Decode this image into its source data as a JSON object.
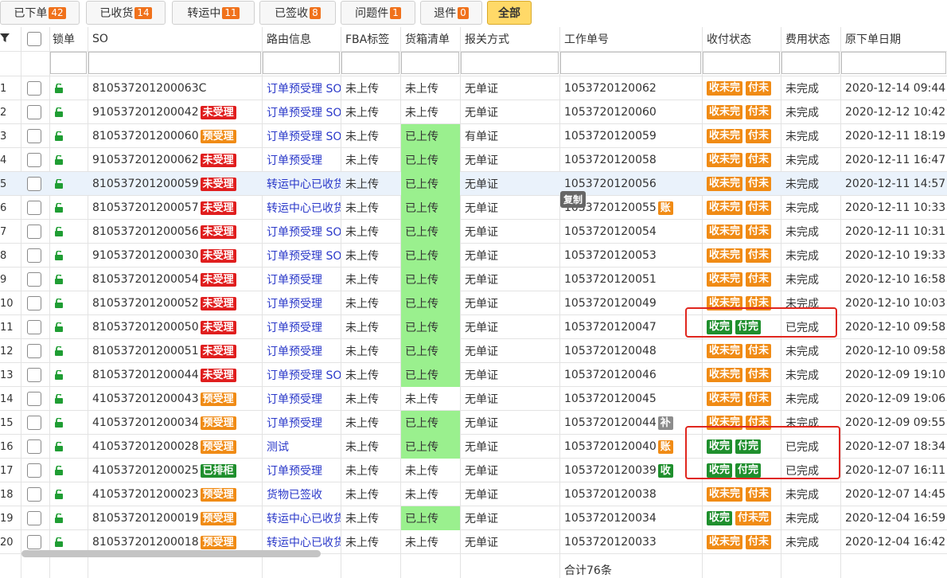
{
  "tabs": [
    {
      "label": "已下单",
      "count": "42"
    },
    {
      "label": "已收货",
      "count": "14"
    },
    {
      "label": "转运中",
      "count": "11"
    },
    {
      "label": "已签收",
      "count": "8"
    },
    {
      "label": "问题件",
      "count": "1"
    },
    {
      "label": "退件",
      "count": "0"
    },
    {
      "label": "全部",
      "count": null
    }
  ],
  "columns": [
    "锁单",
    "SO",
    "路由信息",
    "FBA标签",
    "货箱清单",
    "报关方式",
    "工作单号",
    "收付状态",
    "费用状态",
    "原下单日期"
  ],
  "rows": [
    {
      "n": "1",
      "so": "810537201200063C",
      "badge": null,
      "route": "订单预受理 SO",
      "fba": "未上传",
      "box": "未上传",
      "customs": "无单证",
      "work": "1053720120062",
      "wb": null,
      "pay": [
        "收未完",
        "付未"
      ],
      "fee": "未完成",
      "date": "2020-12-14 09:44"
    },
    {
      "n": "2",
      "so": "910537201200042",
      "badge": "未受理",
      "route": "订单预受理 SO",
      "fba": "未上传",
      "box": "未上传",
      "customs": "无单证",
      "work": "1053720120060",
      "wb": null,
      "pay": [
        "收未完",
        "付未"
      ],
      "fee": "未完成",
      "date": "2020-12-12 10:42"
    },
    {
      "n": "3",
      "so": "810537201200060",
      "badge": "预受理",
      "route": "订单预受理 SO",
      "fba": "未上传",
      "box": "已上传",
      "customs": "有单证",
      "work": "1053720120059",
      "wb": null,
      "pay": [
        "收未完",
        "付未"
      ],
      "fee": "未完成",
      "date": "2020-12-11 18:19"
    },
    {
      "n": "4",
      "so": "910537201200062",
      "badge": "未受理",
      "route": "订单预受理",
      "fba": "未上传",
      "box": "已上传",
      "customs": "无单证",
      "work": "1053720120058",
      "wb": null,
      "pay": [
        "收未完",
        "付未"
      ],
      "fee": "未完成",
      "date": "2020-12-11 16:47"
    },
    {
      "n": "5",
      "so": "810537201200059",
      "badge": "未受理",
      "route": "转运中心已收货",
      "fba": "未上传",
      "box": "已上传",
      "customs": "无单证",
      "work": "1053720120056",
      "wb": null,
      "pay": [
        "收未完",
        "付未"
      ],
      "fee": "未完成",
      "date": "2020-12-11 14:57"
    },
    {
      "n": "6",
      "so": "810537201200057",
      "badge": "未受理",
      "route": "转运中心已收货",
      "fba": "未上传",
      "box": "已上传",
      "customs": "无单证",
      "work": "1053720120055",
      "wb": "账",
      "pay": [
        "收未完",
        "付未"
      ],
      "fee": "未完成",
      "date": "2020-12-11 10:33"
    },
    {
      "n": "7",
      "so": "810537201200056",
      "badge": "未受理",
      "route": "订单预受理 SO",
      "fba": "未上传",
      "box": "已上传",
      "customs": "无单证",
      "work": "1053720120054",
      "wb": null,
      "pay": [
        "收未完",
        "付未"
      ],
      "fee": "未完成",
      "date": "2020-12-11 10:31"
    },
    {
      "n": "8",
      "so": "910537201200030",
      "badge": "未受理",
      "route": "订单预受理 SO",
      "fba": "未上传",
      "box": "已上传",
      "customs": "无单证",
      "work": "1053720120053",
      "wb": null,
      "pay": [
        "收未完",
        "付未"
      ],
      "fee": "未完成",
      "date": "2020-12-10 19:33"
    },
    {
      "n": "9",
      "so": "810537201200054",
      "badge": "未受理",
      "route": "订单预受理",
      "fba": "未上传",
      "box": "已上传",
      "customs": "无单证",
      "work": "1053720120051",
      "wb": null,
      "pay": [
        "收未完",
        "付未"
      ],
      "fee": "未完成",
      "date": "2020-12-10 16:58"
    },
    {
      "n": "10",
      "so": "810537201200052",
      "badge": "未受理",
      "route": "订单预受理",
      "fba": "未上传",
      "box": "已上传",
      "customs": "无单证",
      "work": "1053720120049",
      "wb": null,
      "pay": [
        "收未完",
        "付未"
      ],
      "fee": "未完成",
      "date": "2020-12-10 10:03"
    },
    {
      "n": "11",
      "so": "810537201200050",
      "badge": "未受理",
      "route": "订单预受理",
      "fba": "未上传",
      "box": "已上传",
      "customs": "无单证",
      "work": "1053720120047",
      "wb": null,
      "pay": [
        "收完",
        "付完"
      ],
      "fee": "已完成",
      "date": "2020-12-10 09:58"
    },
    {
      "n": "12",
      "so": "810537201200051",
      "badge": "未受理",
      "route": "订单预受理",
      "fba": "未上传",
      "box": "已上传",
      "customs": "无单证",
      "work": "1053720120048",
      "wb": null,
      "pay": [
        "收未完",
        "付未"
      ],
      "fee": "未完成",
      "date": "2020-12-10 09:58"
    },
    {
      "n": "13",
      "so": "810537201200044",
      "badge": "未受理",
      "route": "订单预受理 SO",
      "fba": "未上传",
      "box": "已上传",
      "customs": "无单证",
      "work": "1053720120046",
      "wb": null,
      "pay": [
        "收未完",
        "付未"
      ],
      "fee": "未完成",
      "date": "2020-12-09 19:10"
    },
    {
      "n": "14",
      "so": "410537201200043",
      "badge": "预受理",
      "route": "订单预受理",
      "fba": "未上传",
      "box": "未上传",
      "customs": "无单证",
      "work": "1053720120045",
      "wb": null,
      "pay": [
        "收未完",
        "付未"
      ],
      "fee": "未完成",
      "date": "2020-12-09 19:06"
    },
    {
      "n": "15",
      "so": "410537201200034",
      "badge": "预受理",
      "route": "订单预受理",
      "fba": "未上传",
      "box": "已上传",
      "customs": "无单证",
      "work": "1053720120044",
      "wb": "补",
      "pay": [
        "收未完",
        "付未"
      ],
      "fee": "未完成",
      "date": "2020-12-09 09:55"
    },
    {
      "n": "16",
      "so": "410537201200028",
      "badge": "预受理",
      "route": "测试",
      "fba": "未上传",
      "box": "已上传",
      "customs": "无单证",
      "work": "1053720120040",
      "wb": "账",
      "pay": [
        "收完",
        "付完"
      ],
      "fee": "已完成",
      "date": "2020-12-07 18:34"
    },
    {
      "n": "17",
      "so": "410537201200025",
      "badge": "已排柜",
      "route": "订单预受理",
      "fba": "未上传",
      "box": "未上传",
      "customs": "无单证",
      "work": "1053720120039",
      "wb": "收",
      "pay": [
        "收完",
        "付完"
      ],
      "fee": "已完成",
      "date": "2020-12-07 16:11"
    },
    {
      "n": "18",
      "so": "410537201200023",
      "badge": "预受理",
      "route": "货物已签收",
      "fba": "未上传",
      "box": "未上传",
      "customs": "无单证",
      "work": "1053720120038",
      "wb": null,
      "pay": [
        "收未完",
        "付未"
      ],
      "fee": "未完成",
      "date": "2020-12-07 14:45"
    },
    {
      "n": "19",
      "so": "810537201200019",
      "badge": "预受理",
      "route": "转运中心已收货",
      "fba": "未上传",
      "box": "已上传",
      "customs": "无单证",
      "work": "1053720120034",
      "wb": null,
      "pay": [
        "收完",
        "付未完"
      ],
      "fee": "未完成",
      "date": "2020-12-04 16:59"
    },
    {
      "n": "20",
      "so": "810537201200018",
      "badge": "预受理",
      "route": "转运中心已收货",
      "fba": "未上传",
      "box": "未上传",
      "customs": "无单证",
      "work": "1053720120033",
      "wb": null,
      "pay": [
        "收未完",
        "付未"
      ],
      "fee": "未完成",
      "date": "2020-12-04 16:42"
    }
  ],
  "tooltip": "复制",
  "footer": "合计76条",
  "colors": {
    "accent_orange": "#f08b15",
    "badge_red": "#e01e1e",
    "badge_green": "#1f8f2d",
    "uploaded_green": "#9af08e",
    "link_blue": "#2a38c9",
    "highlight_row": "#eaf2fb",
    "annotation_red": "#e0261e"
  },
  "icons": {
    "filter": "filter-icon",
    "lock": "unlocked-padlock-icon"
  }
}
